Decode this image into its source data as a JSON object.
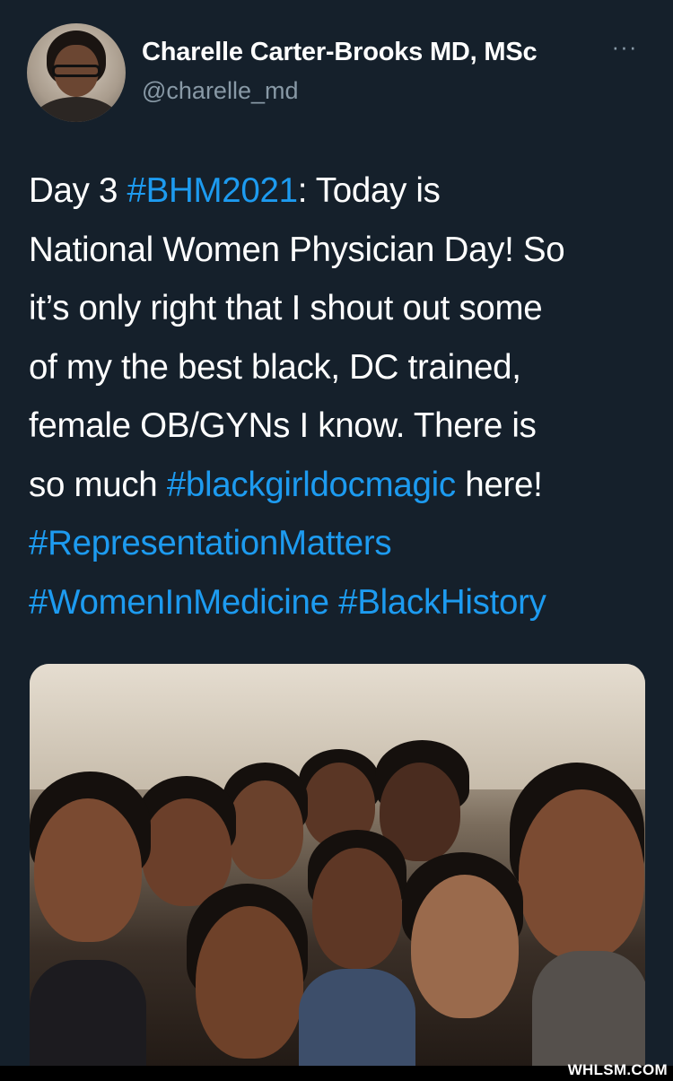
{
  "author": {
    "name": "Charelle Carter-Brooks MD, MSc",
    "handle": "@charelle_md",
    "more_label": "···",
    "avatar_icon": "profile-avatar"
  },
  "tweet": {
    "lines": [
      [
        {
          "t": "Day 3 ",
          "tag": false
        },
        {
          "t": "#BHM2021",
          "tag": true
        },
        {
          "t": ": Today is",
          "tag": false
        }
      ],
      [
        {
          "t": "National Women Physician Day! So",
          "tag": false
        }
      ],
      [
        {
          "t": "it’s only right that I shout out some",
          "tag": false
        }
      ],
      [
        {
          "t": "of my the best black, DC trained,",
          "tag": false
        }
      ],
      [
        {
          "t": "female OB/GYNs I know. There is",
          "tag": false
        }
      ],
      [
        {
          "t": "so much ",
          "tag": false
        },
        {
          "t": "#blackgirldocmagic",
          "tag": true
        },
        {
          "t": " here!",
          "tag": false
        }
      ],
      [
        {
          "t": "#RepresentationMatters",
          "tag": true
        }
      ],
      [
        {
          "t": "#WomenInMedicine",
          "tag": true
        },
        {
          "t": " ",
          "tag": false
        },
        {
          "t": "#BlackHistory",
          "tag": true
        }
      ]
    ]
  },
  "media": {
    "kind": "photo",
    "icon": "group-photo"
  },
  "watermark": "WHLSM.COM",
  "colors": {
    "background": "#15202b",
    "hashtag": "#1d9bf0",
    "secondary": "#8899a6"
  }
}
